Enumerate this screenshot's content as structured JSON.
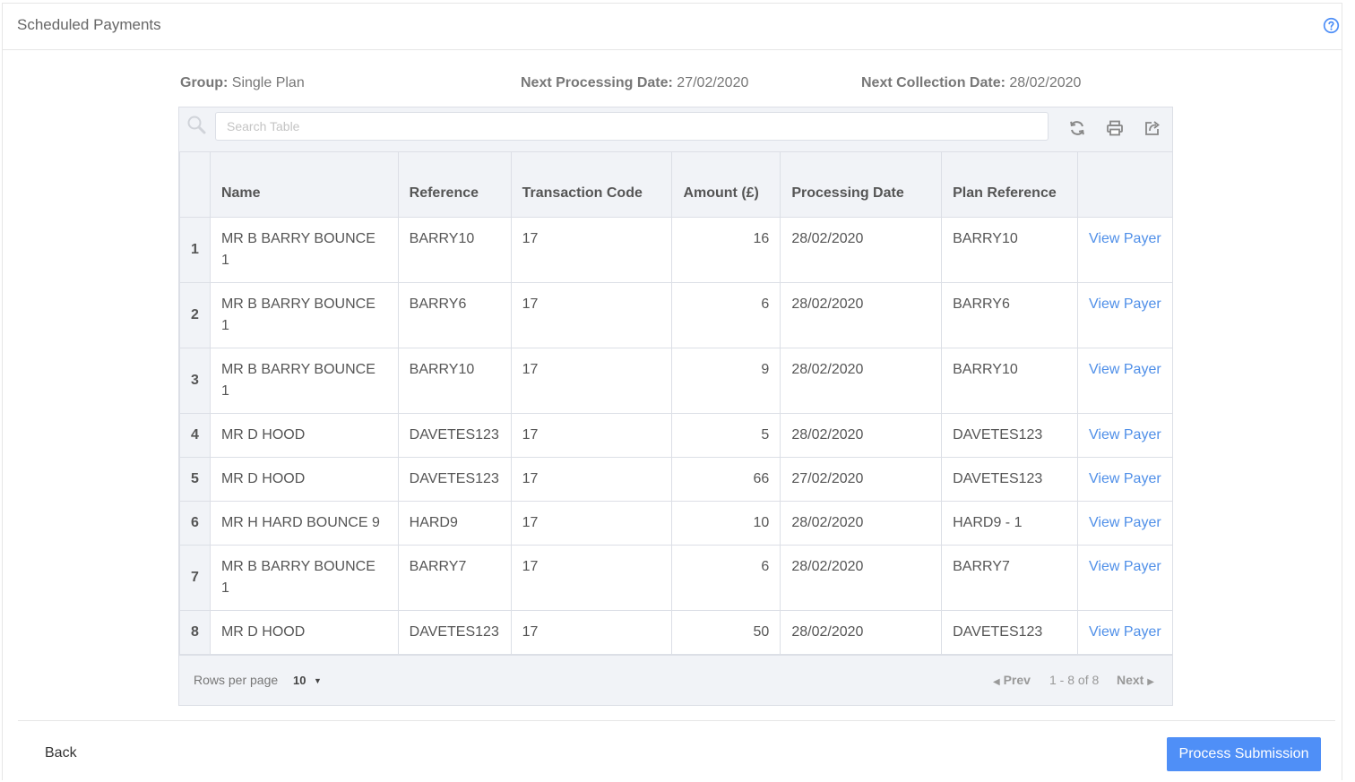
{
  "header": {
    "title": "Scheduled Payments",
    "help_icon": "help-circle-icon"
  },
  "meta": {
    "group_label": "Group:",
    "group_value": "Single Plan",
    "processing_label": "Next Processing Date:",
    "processing_value": "27/02/2020",
    "collection_label": "Next Collection Date:",
    "collection_value": "28/02/2020"
  },
  "toolbar": {
    "search_placeholder": "Search Table",
    "icons": [
      "refresh-icon",
      "print-icon",
      "export-icon"
    ]
  },
  "table": {
    "columns": [
      "",
      "Name",
      "Reference",
      "Transaction Code",
      "Amount (£)",
      "Processing Date",
      "Plan Reference",
      ""
    ],
    "rows": [
      {
        "idx": "1",
        "name": "MR B BARRY BOUNCE 1",
        "reference": "BARRY10",
        "code": "17",
        "amount": "16",
        "date": "28/02/2020",
        "plan": "BARRY10",
        "action": "View Payer"
      },
      {
        "idx": "2",
        "name": "MR B BARRY BOUNCE 1",
        "reference": "BARRY6",
        "code": "17",
        "amount": "6",
        "date": "28/02/2020",
        "plan": "BARRY6",
        "action": "View Payer"
      },
      {
        "idx": "3",
        "name": "MR B BARRY BOUNCE 1",
        "reference": "BARRY10",
        "code": "17",
        "amount": "9",
        "date": "28/02/2020",
        "plan": "BARRY10",
        "action": "View Payer"
      },
      {
        "idx": "4",
        "name": "MR D HOOD",
        "reference": "DAVETES123",
        "code": "17",
        "amount": "5",
        "date": "28/02/2020",
        "plan": "DAVETES123",
        "action": "View Payer"
      },
      {
        "idx": "5",
        "name": "MR D HOOD",
        "reference": "DAVETES123",
        "code": "17",
        "amount": "66",
        "date": "27/02/2020",
        "plan": "DAVETES123",
        "action": "View Payer"
      },
      {
        "idx": "6",
        "name": "MR H HARD BOUNCE 9",
        "reference": "HARD9",
        "code": "17",
        "amount": "10",
        "date": "28/02/2020",
        "plan": "HARD9 - 1",
        "action": "View Payer"
      },
      {
        "idx": "7",
        "name": "MR B BARRY BOUNCE 1",
        "reference": "BARRY7",
        "code": "17",
        "amount": "6",
        "date": "28/02/2020",
        "plan": "BARRY7",
        "action": "View Payer"
      },
      {
        "idx": "8",
        "name": "MR D HOOD",
        "reference": "DAVETES123",
        "code": "17",
        "amount": "50",
        "date": "28/02/2020",
        "plan": "DAVETES123",
        "action": "View Payer"
      }
    ]
  },
  "footer": {
    "rows_per_page_label": "Rows per page",
    "rows_per_page_value": "10",
    "prev_label": "Prev",
    "range_label": "1 - 8 of 8",
    "next_label": "Next"
  },
  "actions": {
    "back_label": "Back",
    "process_label": "Process Submission"
  },
  "colors": {
    "accent": "#4f8ff7",
    "link": "#4f8fe8",
    "header_bg": "#f1f3f7",
    "border": "#dcdfe6"
  }
}
